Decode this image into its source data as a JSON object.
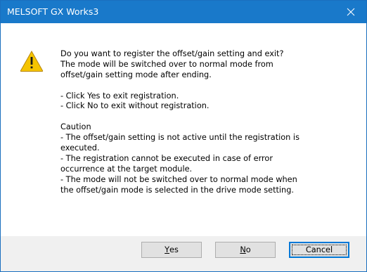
{
  "window": {
    "title": "MELSOFT GX Works3",
    "close_icon": "close-icon",
    "titlebar_color": "#1979ca"
  },
  "dialog": {
    "icon": "warning-icon",
    "icon_color": "#f5c400",
    "lines": [
      "Do you want to register the offset/gain setting and exit?",
      "The mode will be switched over to normal mode from",
      "offset/gain setting mode after ending.",
      "",
      "- Click Yes to exit registration.",
      "- Click No to exit without registration.",
      "",
      "Caution",
      "- The offset/gain setting is not active until the registration is",
      "executed.",
      "- The registration cannot be executed in case of error",
      "occurrence at the target module.",
      "- The mode will not be switched over to normal mode when",
      "the offset/gain mode is selected in the drive mode setting."
    ]
  },
  "buttons": {
    "yes": {
      "mnemonic": "Y",
      "rest": "es"
    },
    "no": {
      "mnemonic": "N",
      "rest": "o"
    },
    "cancel": {
      "label": "Cancel"
    }
  },
  "colors": {
    "accent": "#0078d7",
    "footer": "#f0f0f0",
    "button_face": "#e1e1e1"
  }
}
